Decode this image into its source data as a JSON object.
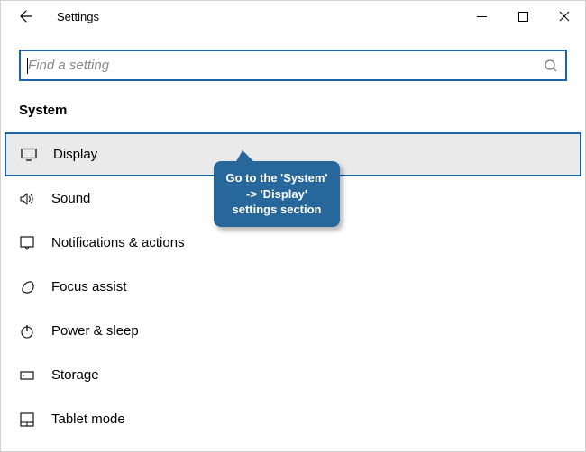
{
  "window": {
    "title": "Settings"
  },
  "search": {
    "placeholder": "Find a setting"
  },
  "section": {
    "title": "System"
  },
  "items": [
    {
      "label": "Display",
      "icon": "display-icon",
      "selected": true
    },
    {
      "label": "Sound",
      "icon": "sound-icon",
      "selected": false
    },
    {
      "label": "Notifications & actions",
      "icon": "notifications-icon",
      "selected": false
    },
    {
      "label": "Focus assist",
      "icon": "focus-assist-icon",
      "selected": false
    },
    {
      "label": "Power & sleep",
      "icon": "power-icon",
      "selected": false
    },
    {
      "label": "Storage",
      "icon": "storage-icon",
      "selected": false
    },
    {
      "label": "Tablet mode",
      "icon": "tablet-mode-icon",
      "selected": false
    }
  ],
  "callout": {
    "text": "Go to the 'System' -> 'Display' settings section"
  },
  "colors": {
    "accent": "#1f63a8",
    "callout": "#28679b",
    "selectedBg": "#eaeaea"
  }
}
